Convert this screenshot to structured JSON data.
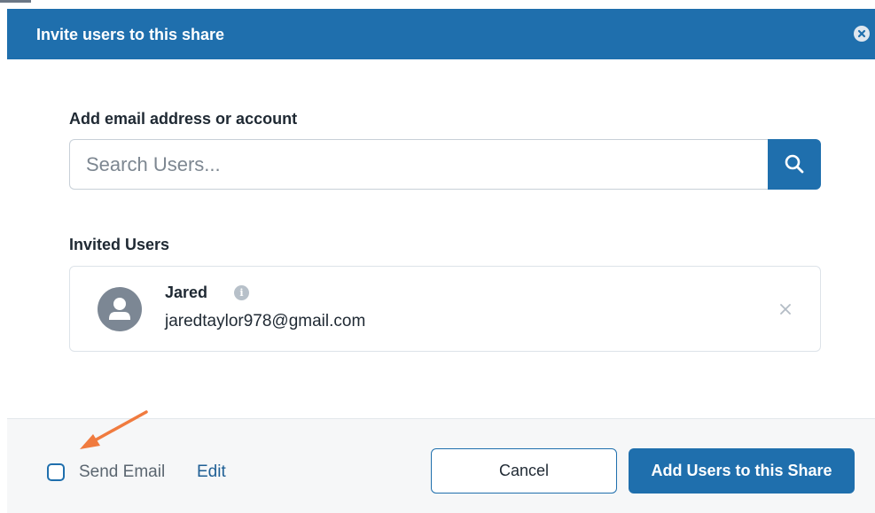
{
  "dialog": {
    "title": "Invite users to this share",
    "close_icon": "close-circle-icon"
  },
  "search": {
    "label": "Add email address or account",
    "placeholder": "Search Users...",
    "value": "",
    "button_icon": "search-icon"
  },
  "invited": {
    "label": "Invited Users",
    "users": [
      {
        "name": "Jared",
        "email": "jaredtaylor978@gmail.com",
        "avatar_icon": "user-avatar-icon",
        "info_icon": "info-icon",
        "remove_icon": "close-icon"
      }
    ]
  },
  "footer": {
    "send_email_label": "Send Email",
    "send_email_checked": false,
    "edit_label": "Edit",
    "cancel_label": "Cancel",
    "submit_label": "Add Users to this Share"
  },
  "colors": {
    "primary": "#1f6fad",
    "annotation_arrow": "#f07b3f"
  }
}
